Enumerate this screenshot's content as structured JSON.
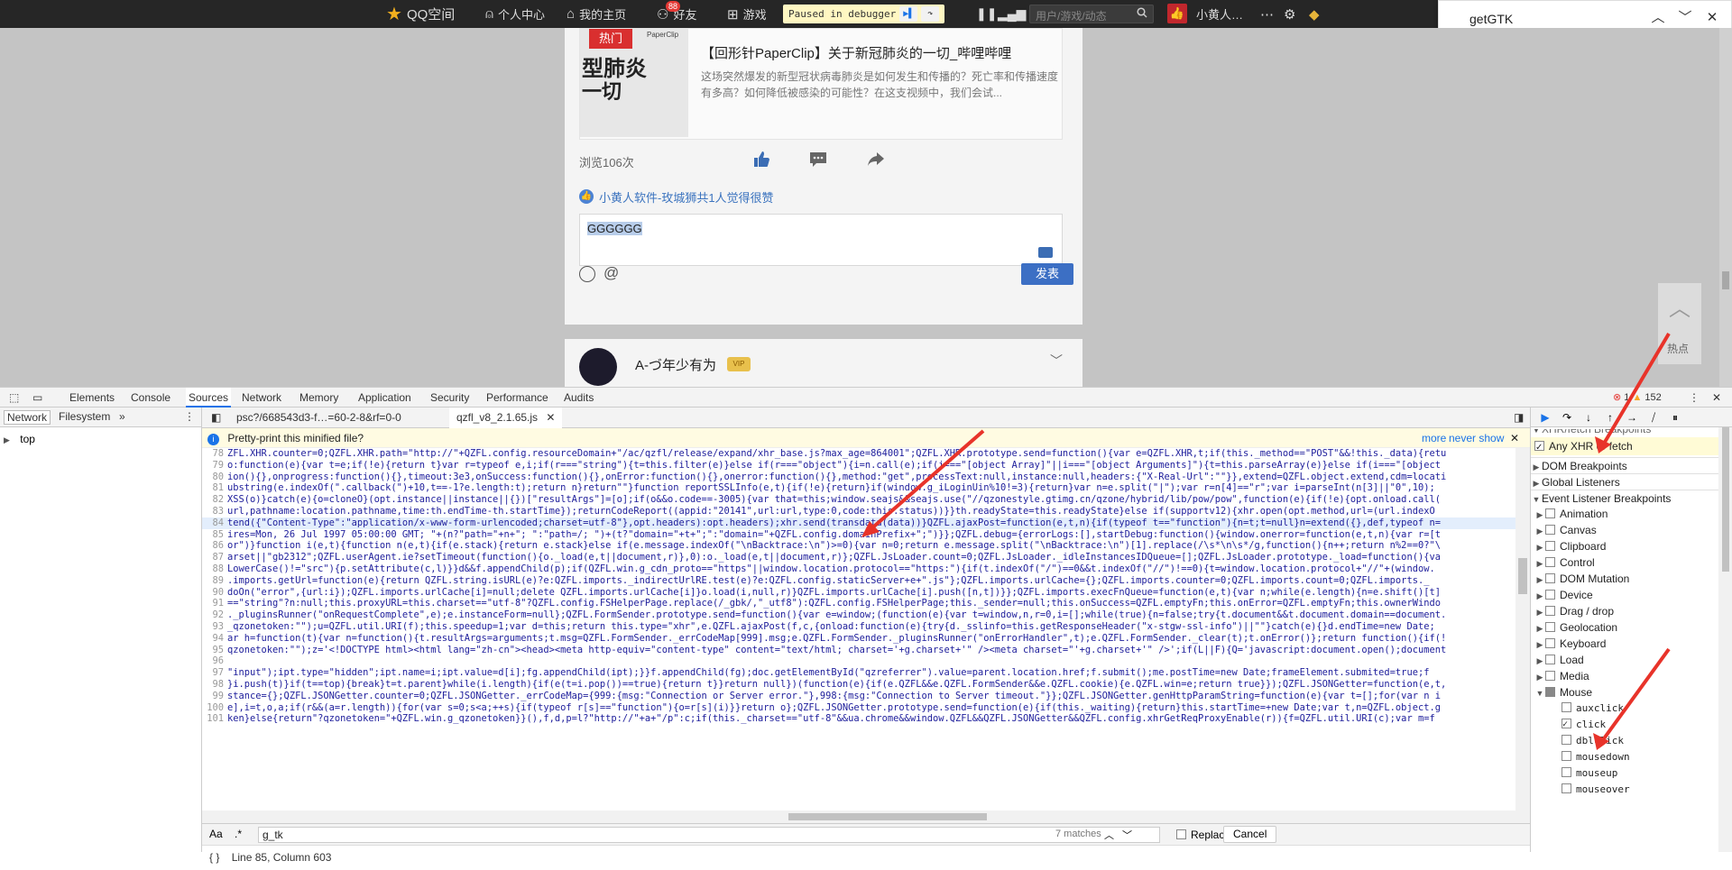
{
  "topbar": {
    "brand": "QQ空间",
    "items": [
      "个人中心",
      "我的主页",
      "好友",
      "游戏"
    ],
    "friends_badge": "88",
    "paused": "Paused in debugger",
    "search_placeholder": "用户/游戏/动态",
    "user": "小黄人…"
  },
  "findbar": {
    "query": "getGTK"
  },
  "feed": {
    "thumb_hot": "热门",
    "thumb_brand": "PaperClip",
    "thumb_line1": "型肺炎",
    "thumb_line2": "一切",
    "title": "【回形针PaperClip】关于新冠肺炎的一切_哔哩哔哩",
    "desc": "这场突然爆发的新型冠状病毒肺炎是如何发生和传播的？死亡率和传播速度有多高？如何降低被感染的可能性？在这支视频中，我们会试...",
    "views": "浏览106次",
    "liked_by": "小黄人软件-玫城狮共1人觉得很赞",
    "comment": "GGGGGG",
    "send": "发表",
    "next_user": "A-づ年少有为",
    "next_vip": "VIP",
    "side_hot": "热点"
  },
  "devtools": {
    "tabs": [
      "Elements",
      "Console",
      "Sources",
      "Network",
      "Memory",
      "Application",
      "Security",
      "Performance",
      "Audits"
    ],
    "active_tab": "Sources",
    "errors": "1",
    "warnings": "152",
    "nav_tabs": [
      "Network",
      "Filesystem"
    ],
    "tree_root": "top",
    "file_tabs": [
      "psc?/668543d3-f…=60-2-8&rf=0-0",
      "qzfl_v8_2.1.65.js"
    ],
    "pretty_msg": "Pretty-print this minified file?",
    "pretty_more": "more",
    "pretty_never": "never show",
    "code_lines": [
      {
        "n": "78",
        "t": "ZFL.XHR.counter=0;QZFL.XHR.path=\"http://\"+QZFL.config.resourceDomain+\"/ac/qzfl/release/expand/xhr_base.js?max_age=864001\";QZFL.XHR.prototype.send=function(){var e=QZFL.XHR,t;if(this._method==\"POST\"&&!this._data){retu"
      },
      {
        "n": "79",
        "t": "o:function(e){var t=e;if(!e){return t}var r=typeof e,i;if(r===\"string\"){t=this.filter(e)}else if(r===\"object\"){i=n.call(e);if(i===\"[object Array]\"||i===\"[object Arguments]\"){t=this.parseArray(e)}else if(i===\"[object"
      },
      {
        "n": "80",
        "t": "ion(){},onprogress:function(){},timeout:3e3,onSuccess:function(){},onError:function(){},onerror:function(){},method:\"get\",processText:null,instance:null,headers:{\"X-Real-Url\":\"\"}},extend=QZFL.object.extend,cdm=locati"
      },
      {
        "n": "81",
        "t": "ubstring(e.indexOf(\".callback(\")+10,t==-1?e.length:t);return n}return\"\"}function reportSSLInfo(e,t){if(!e){return}if(window.g_iLoginUin%10!=3){return}var n=e.split(\"|\");var r=n[4]==\"r\";var i=parseInt(n[3]||\"0\",10);"
      },
      {
        "n": "82",
        "t": "XSS(o)}catch(e){o=cloneO}(opt.instance||instance||{})[\"resultArgs\"]=[o];if(o&&o.code==-3005){var that=this;window.seajs&&seajs.use(\"//qzonestyle.gtimg.cn/qzone/hybrid/lib/pow/pow\",function(e){if(!e){opt.onload.call("
      },
      {
        "n": "83",
        "t": "url,pathname:location.pathname,time:th.endTime-th.startTime});returnCodeReport((appid:\"20141\",url:url,type:0,code:this.status))}}th.readyState=this.readyState}else if(supportv12){xhr.open(opt.method,url=(url.indexO"
      },
      {
        "n": "84",
        "t": "tend({\"Content-Type\":\"application/x-www-form-urlencoded;charset=utf-8\"},opt.headers):opt.headers);xhr.send(transdata(data))}QZFL.ajaxPost=function(e,t,n){if(typeof t==\"function\"){n=t;t=null}n=extend({},def,typeof n=",
        "hl": true
      },
      {
        "n": "85",
        "t": "ires=Mon, 26 Jul 1997 05:00:00 GMT; \"+(n?\"path=\"+n+\"; \":\"path=/; \")+(t?\"domain=\"+t+\";\":\"domain=\"+QZFL.config.domainPrefix+\";\")}};QZFL.debug={errorLogs:[],startDebug:function(){window.onerror=function(e,t,n){var r=[t"
      },
      {
        "n": "86",
        "t": "or\")}function i(e,t){function n(e,t){if(e.stack){return e.stack}else if(e.message.indexOf(\"\\nBacktrace:\\n\")>=0){var n=0;return e.message.split(\"\\nBacktrace:\\n\")[1].replace(/\\s*\\n\\s*/g,function(){n++;return n%2==0?\"\\"
      },
      {
        "n": "87",
        "t": "arset||\"gb2312\";QZFL.userAgent.ie?setTimeout(function(){o._load(e,t||document,r)},0):o._load(e,t||document,r)};QZFL.JsLoader.count=0;QZFL.JsLoader._idleInstancesIDQueue=[];QZFL.JsLoader.prototype._load=function(){va"
      },
      {
        "n": "88",
        "t": "LowerCase()!=\"src\"){p.setAttribute(c,l)}}d&&f.appendChild(p);if(QZFL.win.g_cdn_proto==\"https\"||window.location.protocol==\"https:\"){if(t.indexOf(\"/\")==0&&t.indexOf(\"//\")!==0){t=window.location.protocol+\"//\"+(window."
      },
      {
        "n": "89",
        "t": ".imports.getUrl=function(e){return QZFL.string.isURL(e)?e:QZFL.imports._indirectUrlRE.test(e)?e:QZFL.config.staticServer+e+\".js\"};QZFL.imports.urlCache={};QZFL.imports.counter=0;QZFL.imports.count=0;QZFL.imports._"
      },
      {
        "n": "90",
        "t": "doOn(\"error\",{url:i});QZFL.imports.urlCache[i]=null;delete QZFL.imports.urlCache[i]}o.load(i,null,r)}QZFL.imports.urlCache[i].push([n,t])}};QZFL.imports.execFnQueue=function(e,t){var n;while(e.length){n=e.shift()[t]"
      },
      {
        "n": "91",
        "t": "==\"string\"?n:null;this.proxyURL=this.charset==\"utf-8\"?QZFL.config.FSHelperPage.replace(/_gbk/,\"_utf8\"):QZFL.config.FSHelperPage;this._sender=null;this.onSuccess=QZFL.emptyFn;this.onError=QZFL.emptyFn;this.ownerWindo"
      },
      {
        "n": "92",
        "t": "._pluginsRunner(\"onRequestComplete\",e);e.instanceForm=null};QZFL.FormSender.prototype.send=function(){var e=window;(function(e){var t=window,n,r=0,i=[];while(true){n=false;try{t.document&&t.document.domain==document."
      },
      {
        "n": "93",
        "t": "_qzonetoken:\"\");u=QZFL.util.URI(f);this.speedup=1;var d=this;return this.type=\"xhr\",e.QZFL.ajaxPost(f,c,{onload:function(e){try{d._sslinfo=this.getResponseHeader(\"x-stgw-ssl-info\")||\"\"}catch(e){}d.endTime=new Date;"
      },
      {
        "n": "94",
        "t": "ar h=function(t){var n=function(){t.resultArgs=arguments;t.msg=QZFL.FormSender._errCodeMap[999].msg;e.QZFL.FormSender._pluginsRunner(\"onErrorHandler\",t);e.QZFL.FormSender._clear(t);t.onError()};return function(){if(!"
      },
      {
        "n": "95",
        "t": "qzonetoken:\"\");z='<!DOCTYPE html><html lang=\"zh-cn\"><head><meta http-equiv=\"content-type\" content=\"text/html; charset='+g.charset+'\" /><meta charset=\"'+g.charset+'\" />';if(L||F){Q='javascript:document.open();document"
      },
      {
        "n": "96",
        "t": ""
      },
      {
        "n": "97",
        "t": "\"input\");ipt.type=\"hidden\";ipt.name=i;ipt.value=d[i];fg.appendChild(ipt);}}f.appendChild(fg);doc.getElementById(\"qzreferrer\").value=parent.location.href;f.submit();me.postTime=new Date;frameElement.submited=true;f"
      },
      {
        "n": "98",
        "t": "}i.push(t)}if(t==top){break}t=t.parent}while(i.length){if(e(t=i.pop())==true){return t}}return null})(function(e){if(e.QZFL&&e.QZFL.FormSender&&e.QZFL.cookie){e.QZFL.win=e;return true}});QZFL.JSONGetter=function(e,t,"
      },
      {
        "n": "99",
        "t": "stance={};QZFL.JSONGetter.counter=0;QZFL.JSONGetter._errCodeMap={999:{msg:\"Connection or Server error.\"},998:{msg:\"Connection to Server timeout.\"}};QZFL.JSONGetter.genHttpParamString=function(e){var t=[];for(var n i"
      },
      {
        "n": "100",
        "t": "e],i=t,o,a;if(r&&(a=r.length)){for(var s=0;s<a;++s){if(typeof r[s]==\"function\"){o=r[s](i)}}return o};QZFL.JSONGetter.prototype.send=function(e){if(this._waiting){return}this.startTime=+new Date;var t,n=QZFL.object.g"
      },
      {
        "n": "101",
        "t": "ken}else{return\"?qzonetoken=\"+QZFL.win.g_qzonetoken}}(),f,d,p=l?\"http://\"+a+\"/p\":c;if(this._charset==\"utf-8\"&&ua.chrome&&window.QZFL&&QZFL.JSONGetter&&QZFL.config.xhrGetReqProxyEnable(r)){f=QZFL.util.URI(c);var m=f"
      }
    ],
    "search_query": "g_tk",
    "search_matches": "7 matches",
    "replace_label": "Replace",
    "cancel": "Cancel",
    "status": "Line 85, Column 603",
    "side": {
      "xhr_header": "XHR/fetch Breakpoints",
      "any_xhr": "Any XHR or fetch",
      "sections": [
        "DOM Breakpoints",
        "Global Listeners",
        "Event Listener Breakpoints"
      ],
      "events": [
        "Animation",
        "Canvas",
        "Clipboard",
        "Control",
        "DOM Mutation",
        "Device",
        "Drag / drop",
        "Geolocation",
        "Keyboard",
        "Load",
        "Media",
        "Mouse"
      ],
      "mouse_events": [
        "auxclick",
        "click",
        "dblclick",
        "mousedown",
        "mouseup",
        "mouseover"
      ]
    }
  },
  "colors": {
    "accent": "#1a73e8",
    "arrow": "#e8332a",
    "send_button": "#3c6fc4"
  }
}
